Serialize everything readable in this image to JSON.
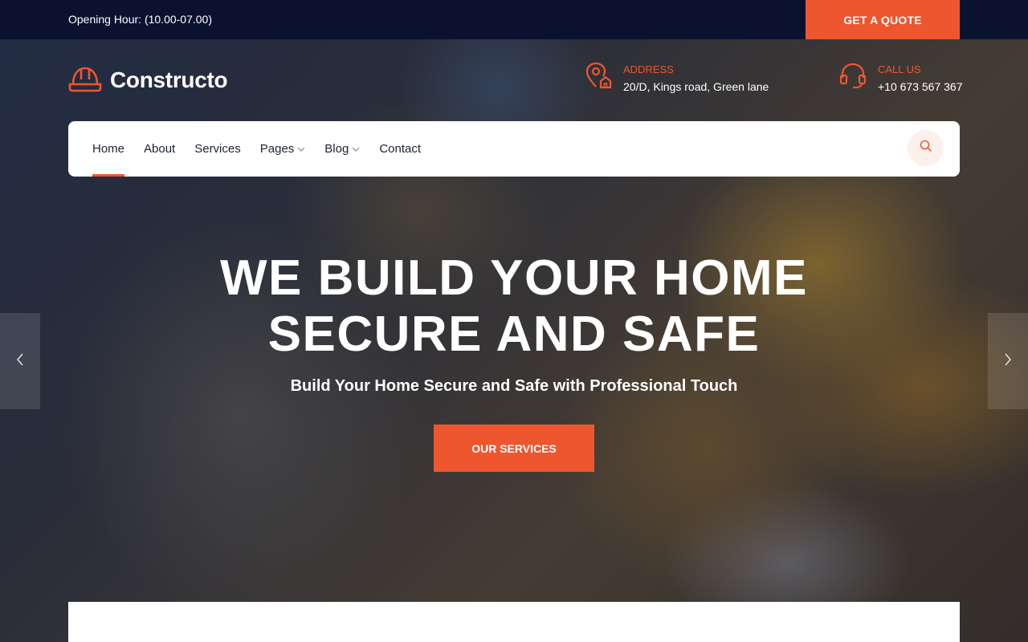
{
  "topbar": {
    "opening_hours": "Opening Hour: (10.00-07.00)",
    "quote_button": "GET A QUOTE"
  },
  "brand": {
    "name": "Constructo",
    "logo_icon": "hard-hat-icon"
  },
  "contact": {
    "address_label": "ADDRESS",
    "address_value": "20/D, Kings road, Green lane",
    "address_icon": "location-home-icon",
    "call_label": "CALL US",
    "call_value": "+10 673 567 367",
    "call_icon": "headset-icon"
  },
  "nav": {
    "items": [
      {
        "label": "Home",
        "active": true,
        "dropdown": false
      },
      {
        "label": "About",
        "active": false,
        "dropdown": false
      },
      {
        "label": "Services",
        "active": false,
        "dropdown": false
      },
      {
        "label": "Pages",
        "active": false,
        "dropdown": true
      },
      {
        "label": "Blog",
        "active": false,
        "dropdown": true
      },
      {
        "label": "Contact",
        "active": false,
        "dropdown": false
      }
    ],
    "search_icon": "search-icon"
  },
  "hero": {
    "title_line1": "WE BUILD YOUR HOME",
    "title_line2": "SECURE AND SAFE",
    "subtitle": "Build Your Home Secure and Safe with Professional Touch",
    "cta_button": "OUR SERVICES"
  },
  "slider": {
    "prev_icon": "chevron-left-icon",
    "next_icon": "chevron-right-icon"
  },
  "colors": {
    "accent": "#ee5630",
    "topbar_bg": "#0b1230",
    "nav_bg": "#ffffff",
    "nav_text": "#1b2233"
  }
}
